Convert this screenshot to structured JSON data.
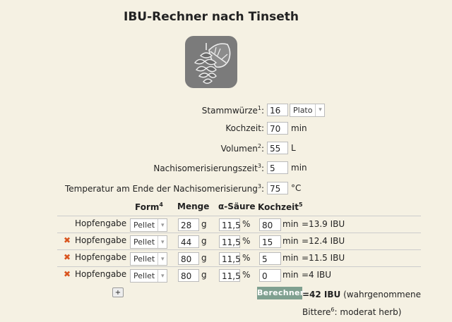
{
  "title": "IBU-Rechner nach Tinseth",
  "fields": {
    "stammwuerze": {
      "label": "Stammwürze",
      "sup": "1",
      "value": "16",
      "unit_select": "Plato"
    },
    "kochzeit": {
      "label": "Kochzeit:",
      "value": "70",
      "unit": "min"
    },
    "volumen": {
      "label": "Volumen",
      "sup": "2",
      "value": "55",
      "unit": "L"
    },
    "nachiso": {
      "label": "Nachisomerisierungszeit",
      "sup": "3",
      "value": "5",
      "unit": "min"
    },
    "temperatur": {
      "label": "Temperatur am Ende der Nachisomerisierung",
      "sup": "3",
      "value": "75",
      "unit": "°C"
    }
  },
  "table": {
    "headers": {
      "form": "Form",
      "form_sup": "4",
      "menge": "Menge",
      "saeure": "α-Säure",
      "kochzeit": "Kochzeit",
      "kochzeit_sup": "5"
    },
    "rows": [
      {
        "label": "Hopfengabe",
        "form": "Pellet",
        "menge": "28",
        "menge_unit": "g",
        "saeure": "11,5",
        "saeure_unit": "%",
        "kochzeit": "80",
        "kochzeit_unit": "min",
        "ibu": "=13.9 IBU",
        "deletable": false
      },
      {
        "label": "Hopfengabe",
        "form": "Pellet",
        "menge": "44",
        "menge_unit": "g",
        "saeure": "11,5",
        "saeure_unit": "%",
        "kochzeit": "15",
        "kochzeit_unit": "min",
        "ibu": "=12.4 IBU",
        "deletable": true
      },
      {
        "label": "Hopfengabe",
        "form": "Pellet",
        "menge": "80",
        "menge_unit": "g",
        "saeure": "11,5",
        "saeure_unit": "%",
        "kochzeit": "5",
        "kochzeit_unit": "min",
        "ibu": "=11.5 IBU",
        "deletable": true
      },
      {
        "label": "Hopfengabe",
        "form": "Pellet",
        "menge": "80",
        "menge_unit": "g",
        "saeure": "11,5",
        "saeure_unit": "%",
        "kochzeit": "0",
        "kochzeit_unit": "min",
        "ibu": "=4 IBU",
        "deletable": true
      }
    ]
  },
  "actions": {
    "add_label": "+",
    "calc_label": "Berechnen"
  },
  "result": {
    "total": "=42 IBU",
    "text_a": " (wahrgenommene Bittere",
    "sup": "6",
    "text_b": ": moderat herb)"
  },
  "icons": {
    "logo": "hop-icon",
    "delete": "delete-icon",
    "dropdown": "chevron-down-icon"
  }
}
